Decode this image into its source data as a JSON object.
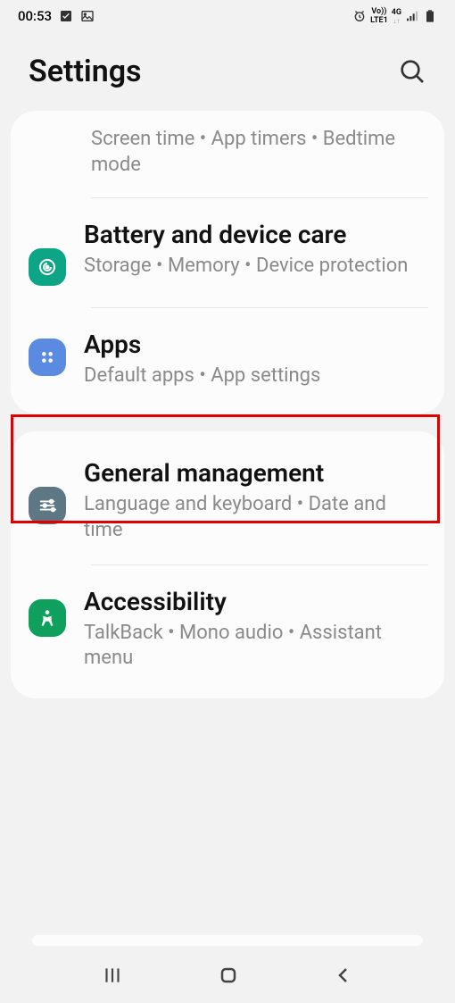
{
  "status": {
    "time": "00:53",
    "network_label_top": "Vo))",
    "network_label_bottom": "LTE1",
    "network_type": "4G"
  },
  "header": {
    "title": "Settings"
  },
  "cards": [
    {
      "items": [
        {
          "title": "",
          "sub": "Screen time  •  App timers  •  Bedtime mode"
        },
        {
          "title": "Battery and device care",
          "sub": "Storage  •  Memory  •  Device protection",
          "icon_color": "#0ea586"
        },
        {
          "title": "Apps",
          "sub": "Default apps  •  App settings",
          "icon_color": "#5a8be0",
          "highlighted": true
        }
      ]
    },
    {
      "items": [
        {
          "title": "General management",
          "sub": "Language and keyboard  •  Date and time",
          "icon_color": "#5d7784"
        },
        {
          "title": "Accessibility",
          "sub": "TalkBack  •  Mono audio  •  Assistant menu",
          "icon_color": "#0ea05c"
        }
      ]
    }
  ]
}
